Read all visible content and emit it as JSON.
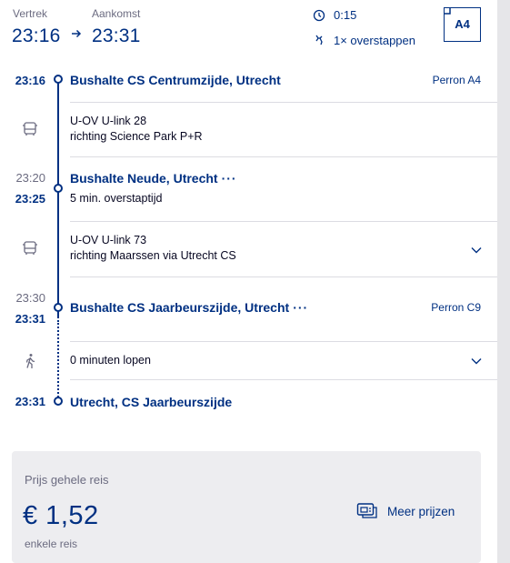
{
  "header": {
    "departure_label": "Vertrek",
    "arrival_label": "Aankomst",
    "departure_time": "23:16",
    "arrival_time": "23:31",
    "duration": "0:15",
    "transfers": "1× overstappen",
    "platform_badge": "A4"
  },
  "timeline": {
    "stops": [
      {
        "time_arr": "",
        "time_dep": "23:16",
        "name": "Bushalte CS Centrumzijde, Utrecht",
        "platform": "Perron A4",
        "note": ""
      },
      {
        "time_arr": "23:20",
        "time_dep": "23:25",
        "name": "Bushalte Neude, Utrecht",
        "platform": "",
        "note": "5 min. overstaptijd",
        "more": "···"
      },
      {
        "time_arr": "23:30",
        "time_dep": "23:31",
        "name": "Bushalte CS Jaarbeurszijde, Utrecht",
        "platform": "Perron C9",
        "note": "",
        "more": "···"
      },
      {
        "time_arr": "",
        "time_dep": "23:31",
        "name": "Utrecht, CS Jaarbeurszijde",
        "platform": "",
        "note": ""
      }
    ],
    "legs": [
      {
        "icon": "bus-icon",
        "line": "U-OV U-link 28",
        "direction": "richting Science Park P+R"
      },
      {
        "icon": "bus-icon",
        "line": "U-OV U-link 73",
        "direction": "richting Maarssen via Utrecht CS"
      },
      {
        "icon": "walk-icon",
        "line": "0 minuten lopen",
        "direction": ""
      }
    ]
  },
  "price": {
    "label": "Prijs gehele reis",
    "amount": "€  1,52",
    "type": "enkele reis",
    "more_prices": "Meer prijzen"
  },
  "colors": {
    "brand_blue": "#003082",
    "text": "#070721",
    "muted": "#6b6b80",
    "card_bg": "#ededf0"
  }
}
